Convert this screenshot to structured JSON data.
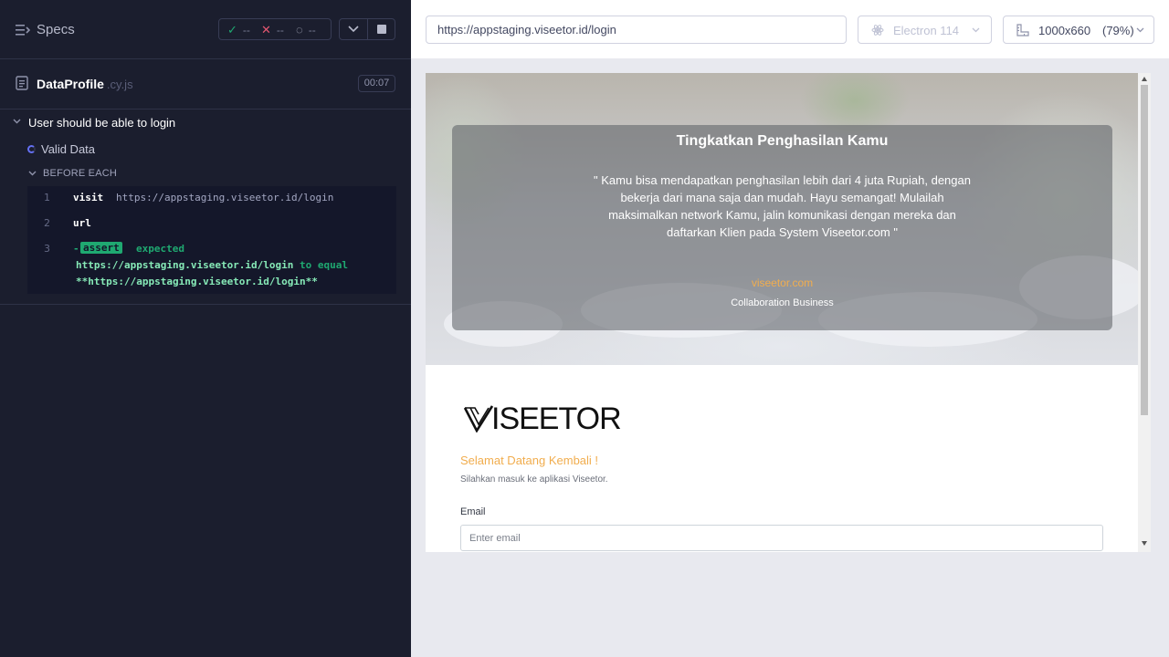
{
  "reporter": {
    "specs_label": "Specs",
    "stats": {
      "passed": "--",
      "failed": "--",
      "pending": "--"
    },
    "file": {
      "name": "DataProfile",
      "ext": ".cy.js",
      "duration": "00:07"
    },
    "suite_title": "User should be able to login",
    "test_title": "Valid Data",
    "hook_label": "BEFORE EACH",
    "commands": [
      {
        "num": "1",
        "name": "visit",
        "message": "https://appstaging.viseetor.id/login"
      },
      {
        "num": "2",
        "name": "url",
        "message": ""
      },
      {
        "num": "3",
        "dash": "-",
        "name": "assert",
        "expected": "expected",
        "actual": "https://appstaging.viseetor.id/login",
        "to_equal": "to equal",
        "expected_value": "**https://appstaging.viseetor.id/login**"
      }
    ]
  },
  "preview": {
    "url": "https://appstaging.viseetor.id/login",
    "browser": "Electron 114",
    "viewport": "1000x660",
    "scale": "(79%)",
    "page": {
      "hero_title": "Tingkatkan Penghasilan Kamu",
      "hero_quote": "\" Kamu bisa mendapatkan penghasilan lebih dari 4 juta Rupiah, dengan bekerja dari mana saja dan mudah. Hayu semangat! Mulailah maksimalkan network Kamu, jalin komunikasi dengan mereka dan daftarkan Klien pada System Viseetor.com \"",
      "hero_brand": "viseetor.com",
      "hero_sub": "Collaboration Business",
      "logo_text": "ISEETOR",
      "welcome": "Selamat Datang Kembali !",
      "welcome_sub": "Silahkan masuk ke aplikasi Viseetor.",
      "email_label": "Email",
      "email_placeholder": "Enter email"
    }
  },
  "colors": {
    "pass": "#1fa971",
    "fail": "#e45770",
    "accent": "#f1ad4e",
    "running": "#6470f3"
  },
  "icons": [
    "specs-list-icon",
    "check-icon",
    "x-icon",
    "spinner-icon",
    "chevron-down-icon",
    "stop-icon",
    "file-icon",
    "electron-icon",
    "ruler-icon"
  ]
}
